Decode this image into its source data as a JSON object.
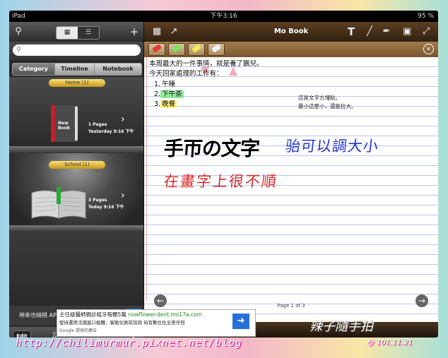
{
  "status": {
    "device": "iPad",
    "time": "下午3:16",
    "battery": "95 %"
  },
  "left": {
    "search_placeholder": "",
    "tabs": [
      "Category",
      "Timeline",
      "Notebook Title"
    ],
    "shelves": [
      {
        "name": "Home (1)",
        "book_title": "New Book",
        "pages": "1 Pages",
        "date": "Yesterday 9:16 下午"
      },
      {
        "name": "School (1)",
        "book_title": "",
        "pages": "3 Pages",
        "date": "Today 9:16 下午"
      }
    ],
    "ad_text": "神來也暗棋 APP 下載對戰 GO",
    "edit_label": "Edit"
  },
  "right": {
    "title": "Mo Book",
    "lines": [
      "本周最大的一件事情，就是養了鵝兒。",
      "今天回家處理的工作有："
    ],
    "list": [
      {
        "num": "1.",
        "text": "午睡",
        "color": "#ffffff"
      },
      {
        "num": "2.",
        "text": "下午茶",
        "color": "#8fe89a"
      },
      {
        "num": "3.",
        "text": "晚餐",
        "color": "#fff27a"
      }
    ],
    "side_note": [
      "這是文字方塊貼。",
      "最小這麼小，還能拉大。"
    ],
    "handwriting": {
      "line1": "手帀の文字",
      "line1b": "骀可以調大小",
      "line2": "在畫字上很不順"
    },
    "page_label": "Page 1 of 3"
  },
  "ad": {
    "line1": "主任級醫師親診植牙每顆5萬",
    "url": "nowflower-dent.mo17a.com",
    "line2": "堅持選用法國進口植體，客製化術前諮詢 另有數位化全瓷牙冠",
    "line3": "Google 提供的廣告"
  },
  "watermark": "http://chilimurmur.pixnet.net/blog",
  "signature": "辣子隨手拍",
  "date": "@ 101.11.21",
  "colors": {
    "accent_blue": "#2870d8",
    "toolbar_brown": "#5c3f22",
    "line_blue": "#b7c7f2"
  }
}
